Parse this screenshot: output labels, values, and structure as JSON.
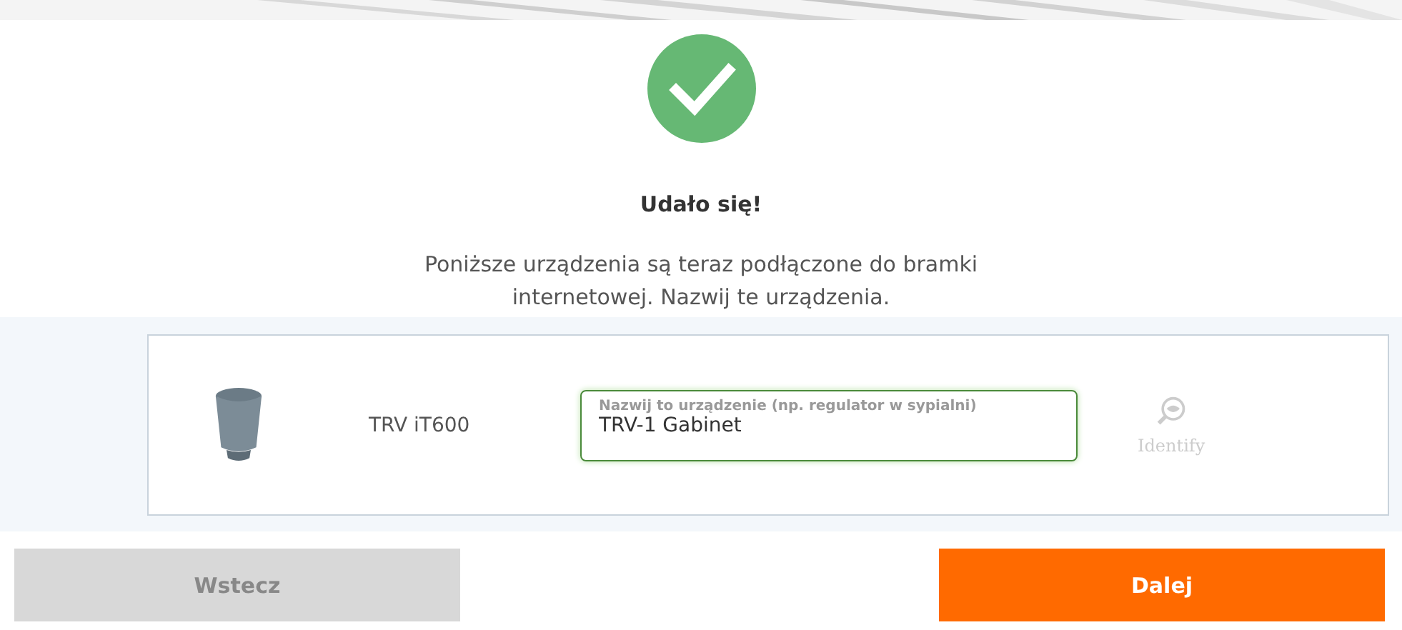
{
  "result": {
    "title": "Udało się!",
    "message": "Poniższe urządzenia są teraz podłączone do bramki internetowej. Nazwij te urządzenia."
  },
  "devices": [
    {
      "model": "TRV iT600",
      "name_field": {
        "placeholder": "Nazwij to urządzenie (np. regulator w sypialni)",
        "value": "TRV-1 Gabinet",
        "valid": true
      },
      "identify": {
        "label": "Identify",
        "disabled": true
      }
    }
  ],
  "buttons": [
    {
      "label": "Wstecz",
      "kind": "secondary"
    },
    {
      "label": "Dalej",
      "kind": "primary"
    }
  ]
}
